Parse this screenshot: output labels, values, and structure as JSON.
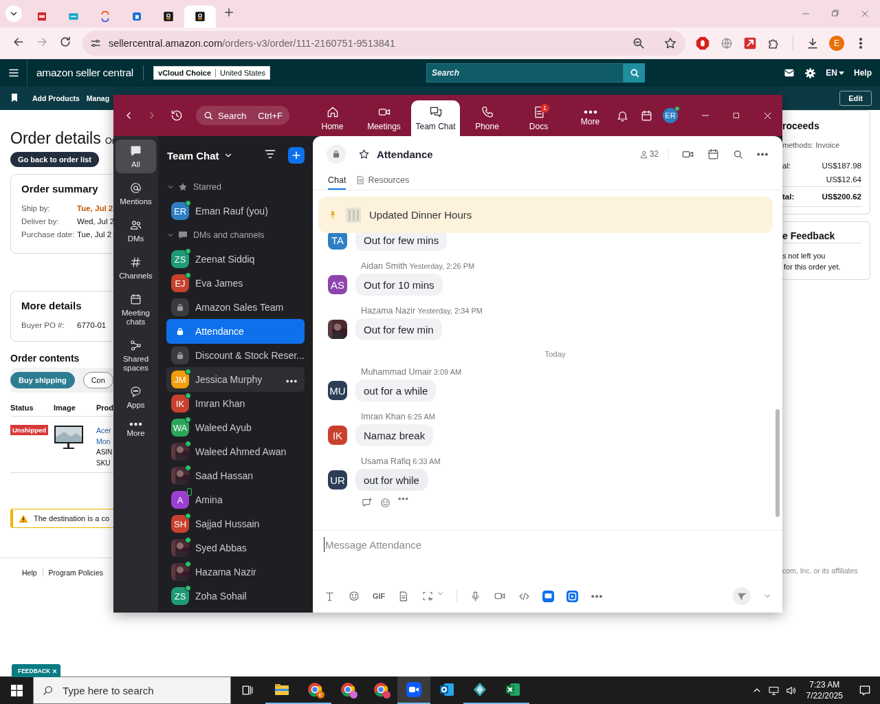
{
  "browser": {
    "tabs": [
      {
        "kind": "red",
        "selected": false
      },
      {
        "kind": "teal",
        "selected": false
      },
      {
        "kind": "swirl",
        "selected": false
      },
      {
        "kind": "blue",
        "selected": false
      },
      {
        "kind": "amazon",
        "selected": false
      },
      {
        "kind": "amazon",
        "selected": true
      }
    ],
    "url_domain": "sellercentral.amazon.com",
    "url_path": "/orders-v3/order/111-2160751-9513841",
    "profile_initial": "E"
  },
  "seller_header": {
    "logo": "amazon seller central",
    "store": "vCloud Choice",
    "region": "United States",
    "search_placeholder": "Search",
    "language": "EN",
    "help": "Help"
  },
  "seller_nav": {
    "items": [
      "Add Products",
      "Manag"
    ],
    "edit": "Edit"
  },
  "order": {
    "title": "Order details",
    "title_suffix": "Or",
    "back": "Go back to order list",
    "summary": {
      "title": "Order summary",
      "rows": [
        {
          "label": "Ship by:",
          "value": "Tue, Jul 2",
          "emphasis": true
        },
        {
          "label": "Deliver by:",
          "value": "Wed, Jul 2",
          "emphasis": false
        },
        {
          "label": "Purchase date:",
          "value": "Tue, Jul 2",
          "emphasis": false
        }
      ]
    },
    "more": {
      "title": "More details",
      "rows": [
        {
          "label": "Buyer PO #:",
          "value": "6770-01"
        }
      ]
    },
    "contents": {
      "title": "Order contents",
      "buttons": [
        {
          "label": "Buy shipping",
          "primary": true
        },
        {
          "label": "Con",
          "primary": false
        }
      ],
      "columns": [
        "Status",
        "Image",
        "Prod"
      ],
      "rows": [
        {
          "status": "Unshipped",
          "image": {
            "kind": "picture"
          },
          "product": [
            "Acer",
            "Mon"
          ],
          "details": [
            "ASIN",
            "SKU"
          ]
        }
      ]
    },
    "alert": "The destination is a co",
    "footer_links": [
      "Help",
      "Program Policies"
    ],
    "proceeds": {
      "title": "roceeds",
      "subtitle": "methods: Invoice",
      "rows": [
        {
          "label": "al:",
          "value": "US$187.98",
          "total": false
        },
        {
          "value": "US$12.64",
          "total": false
        },
        {
          "label": "tal:",
          "value": "US$200.62",
          "total": true
        }
      ]
    },
    "feedback": {
      "title": "e Feedback",
      "lines": [
        "s not left you",
        "for this order yet."
      ]
    },
    "copyright": "com, Inc. or its affiliates"
  },
  "zoom": {
    "search": "Search",
    "shortcut": "Ctrl+F",
    "tabs": [
      {
        "label": "Home",
        "kind": "home",
        "selected": false
      },
      {
        "label": "Meetings",
        "kind": "meetings",
        "selected": false
      },
      {
        "label": "Team Chat",
        "kind": "chat",
        "selected": true
      },
      {
        "label": "Phone",
        "kind": "phone",
        "selected": false
      },
      {
        "label": "Docs",
        "kind": "docs",
        "selected": false,
        "badge": "1"
      },
      {
        "label": "More",
        "kind": "more",
        "selected": false
      }
    ],
    "user_initials": "ER",
    "rail": [
      {
        "label": "All",
        "kind": "all",
        "selected": true
      },
      {
        "label": "Mentions",
        "kind": "mentions",
        "selected": false
      },
      {
        "label": "DMs",
        "kind": "dms",
        "selected": false
      },
      {
        "label": "Channels",
        "kind": "channels",
        "selected": false
      },
      {
        "label": "Meeting chats",
        "kind": "meetings",
        "selected": false
      },
      {
        "label": "Shared spaces",
        "kind": "shared",
        "selected": false
      },
      {
        "label": "Apps",
        "kind": "apps",
        "selected": false
      },
      {
        "label": "More",
        "kind": "more",
        "selected": false
      }
    ],
    "sidebar": {
      "title": "Team Chat",
      "sections": [
        {
          "label": "Starred",
          "kind": "starred",
          "expanded": true,
          "items": [
            {
              "name": "Eman Rauf (you)",
              "kind": "initials",
              "initials": "ER",
              "color": "#2e7fc4",
              "online": true,
              "mobile": false,
              "selected": false,
              "hovered": false
            }
          ]
        },
        {
          "label": "DMs and channels",
          "kind": "dms",
          "expanded": true,
          "items": [
            {
              "name": "Zeenat Siddiq",
              "kind": "initials",
              "initials": "ZS",
              "color": "#1f9a77",
              "online": true,
              "mobile": false,
              "selected": false,
              "hovered": false
            },
            {
              "name": "Eva James",
              "kind": "initials",
              "initials": "EJ",
              "color": "#c8412f",
              "online": true,
              "mobile": false,
              "selected": false,
              "hovered": false
            },
            {
              "name": "Amazon Sales Team",
              "kind": "lock",
              "selected": false,
              "hovered": false
            },
            {
              "name": "Attendance",
              "kind": "lock",
              "selected": true,
              "hovered": false
            },
            {
              "name": "Discount & Stock Reser...",
              "kind": "lock",
              "selected": false,
              "hovered": false
            },
            {
              "name": "Jessica Murphy",
              "kind": "initials",
              "initials": "JM",
              "color": "#f29d0c",
              "online": true,
              "mobile": false,
              "selected": false,
              "hovered": true
            },
            {
              "name": "Imran Khan",
              "kind": "initials",
              "initials": "IK",
              "color": "#c8412f",
              "online": true,
              "mobile": false,
              "selected": false,
              "hovered": false
            },
            {
              "name": "Waleed Ayub",
              "kind": "initials",
              "initials": "WA",
              "color": "#2ea65a",
              "online": true,
              "mobile": false,
              "selected": false,
              "hovered": false
            },
            {
              "name": "Waleed Ahmed Awan",
              "online": true,
              "mobile": false,
              "selected": false,
              "hovered": false
            },
            {
              "name": "Saad Hassan",
              "online": true,
              "mobile": false,
              "selected": false,
              "hovered": false
            },
            {
              "name": "Amina",
              "kind": "initials",
              "initials": "A",
              "color": "#9a3fcf",
              "online": false,
              "mobile": true,
              "selected": false,
              "hovered": false
            },
            {
              "name": "Sajjad Hussain",
              "kind": "initials",
              "initials": "SH",
              "color": "#c8412f",
              "online": true,
              "mobile": false,
              "selected": false,
              "hovered": false
            },
            {
              "name": "Syed Abbas",
              "online": true,
              "mobile": false,
              "selected": false,
              "hovered": false
            },
            {
              "name": "Hazama Nazir",
              "online": true,
              "mobile": false,
              "selected": false,
              "hovered": false
            },
            {
              "name": "Zoha Sohail",
              "kind": "initials",
              "initials": "ZS",
              "color": "#1f9a77",
              "online": true,
              "mobile": false,
              "selected": false,
              "hovered": false
            }
          ]
        }
      ]
    },
    "chat": {
      "channel": "Attendance",
      "private": true,
      "starred": false,
      "members": "32",
      "tabs": [
        {
          "label": "Chat",
          "selected": true
        },
        {
          "label": "Resources",
          "selected": false
        }
      ],
      "pinned": "Updated Dinner Hours",
      "messages": [
        {
          "kind": "message",
          "photo": false,
          "initials": "TA",
          "color": "#2e7fc4",
          "text": "Out for few mins",
          "hovered": false
        },
        {
          "kind": "message",
          "sender": "Aidan Smith",
          "time": "Yesterday, 2:26 PM",
          "photo": false,
          "initials": "AS",
          "color": "#8e44ad",
          "text": "Out for 10 mins",
          "hovered": false
        },
        {
          "kind": "message",
          "sender": "Hazama Nazir",
          "time": "Yesterday, 2:34 PM",
          "photo": true,
          "text": "Out for few min",
          "hovered": false
        },
        {
          "kind": "divider",
          "label": "Today"
        },
        {
          "kind": "message",
          "sender": "Muhammad Umair",
          "time": "3:09 AM",
          "photo": false,
          "initials": "MU",
          "color": "#2c3e55",
          "text": "out for a while",
          "hovered": false
        },
        {
          "kind": "message",
          "sender": "Imran Khan",
          "time": "6:25 AM",
          "photo": false,
          "initials": "IK",
          "color": "#c8412f",
          "text": "Namaz break",
          "hovered": false
        },
        {
          "kind": "message",
          "sender": "Usama Rafiq",
          "time": "6:33 AM",
          "photo": false,
          "initials": "UR",
          "color": "#2c3e55",
          "text": "out for while",
          "hovered": true
        }
      ],
      "composer_placeholder": "Message Attendance",
      "gif": "GIF"
    }
  },
  "feedback": {
    "label": "FEEDBACK",
    "close": "×"
  },
  "taskbar": {
    "search_placeholder": "Type here to search",
    "apps": [
      {
        "kind": "explorer",
        "running": true,
        "active": false
      },
      {
        "kind": "chrome",
        "badge": "E",
        "color": "#e8710a",
        "running": true,
        "active": false
      },
      {
        "kind": "chrome",
        "color": "#c86dd7",
        "running": false,
        "active": false
      },
      {
        "kind": "chrome",
        "color": "#e0426a",
        "running": false,
        "active": false
      },
      {
        "kind": "zoom",
        "running": true,
        "active": true
      },
      {
        "kind": "outlook",
        "running": false,
        "active": false
      },
      {
        "kind": "diamond",
        "running": true,
        "active": false
      },
      {
        "kind": "excel",
        "running": true,
        "active": false
      }
    ],
    "time": "7:23 AM",
    "date": "7/22/2025"
  }
}
